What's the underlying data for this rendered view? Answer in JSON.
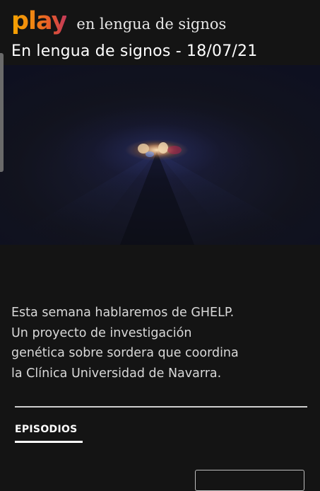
{
  "header": {
    "logo_text": "play",
    "subtitle": "en lengua de signos",
    "episode_title": "En lengua de signos - 18/07/21"
  },
  "video": {
    "thumbnail": "video-frame"
  },
  "description": {
    "lines": [
      "Esta semana hablaremos de GHELP.",
      "Un proyecto de investigación",
      "genética sobre sordera que coordina",
      "la Clínica Universidad de Navarra."
    ]
  },
  "tabs": {
    "episodes_label": "EPISODIOS"
  },
  "colors": {
    "background": "#141414",
    "logo_start": "#f5a300",
    "logo_end": "#c2395a",
    "text": "#ffffff"
  }
}
